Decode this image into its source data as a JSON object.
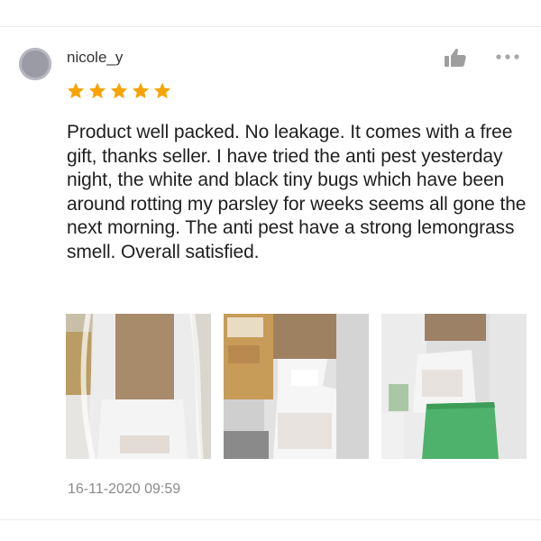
{
  "review": {
    "username": "nicole_y",
    "rating": 5,
    "max_rating": 5,
    "text": "Product well packed. No leakage. It comes with a free gift, thanks seller. I have tried the anti pest yesterday night, the white and black tiny bugs which have been around rotting my parsley for weeks seems all gone the next morning. The anti pest have a strong lemongrass smell. Overall satisfied.",
    "timestamp": "16-11-2020 09:59",
    "photo_count": 3
  },
  "icons": {
    "like": "thumbs-up-icon",
    "more": "more-options-icon",
    "star": "star-icon"
  },
  "colors": {
    "star": "#f7a400",
    "avatar": "#9a9ba5",
    "text": "#1f1f1f",
    "muted": "#8a8a8a",
    "icon": "#9e9e9e"
  }
}
